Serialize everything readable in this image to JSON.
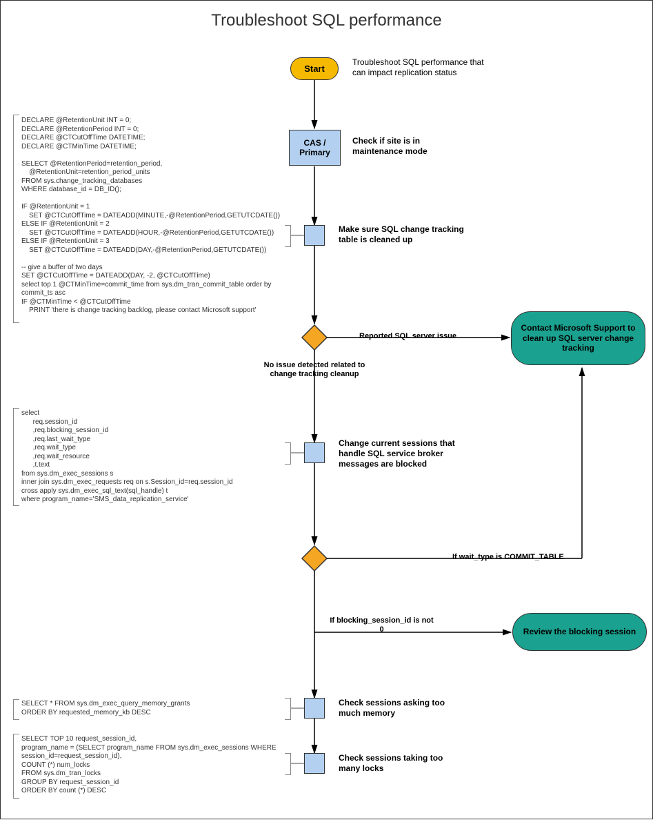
{
  "title": "Troubleshoot SQL performance",
  "nodes": {
    "start": "Start",
    "cas": "CAS / Primary",
    "contact": "Contact Microsoft Support to clean up SQL server change tracking",
    "review": "Review the blocking session"
  },
  "labels": {
    "start_desc": "Troubleshoot SQL performance that can impact replication status",
    "maint": "Check if site is in maintenance mode",
    "cleanup": "Make sure SQL change tracking table is cleaned up",
    "blocked": "Change current sessions that handle SQL service broker messages are blocked",
    "memory": "Check sessions asking too much memory",
    "locks": "Check sessions taking too many locks"
  },
  "edges": {
    "reported": "Reported SQL server issue",
    "noissue": "No issue detected related to change tracking cleanup",
    "commit": "If wait_type is COMMIT_TABLE",
    "notzero": "If blocking_session_id is not 0"
  },
  "code": {
    "c1": "DECLARE @RetentionUnit INT = 0;\nDECLARE @RetentionPeriod INT = 0;\nDECLARE @CTCutOffTime DATETIME;\nDECLARE @CTMinTime DATETIME;\n\nSELECT @RetentionPeriod=retention_period,\n    @RetentionUnit=retention_period_units\nFROM sys.change_tracking_databases\nWHERE database_id = DB_ID();\n\nIF @RetentionUnit = 1\n    SET @CTCutOffTime = DATEADD(MINUTE,-@RetentionPeriod,GETUTCDATE())\nELSE IF @RetentionUnit = 2\n    SET @CTCutOffTime = DATEADD(HOUR,-@RetentionPeriod,GETUTCDATE())\nELSE IF @RetentionUnit = 3\n    SET @CTCutOffTime = DATEADD(DAY,-@RetentionPeriod,GETUTCDATE())\n\n-- give a buffer of two days\nSET @CTCutOffTime = DATEADD(DAY, -2, @CTCutOffTime)\nselect top 1 @CTMinTime=commit_time from sys.dm_tran_commit_table order by\ncommit_ts asc\nIF @CTMinTime < @CTCutOffTime\n    PRINT 'there is change tracking backlog, please contact Microsoft support'",
    "c2": "select\n      req.session_id\n      ,req.blocking_session_id\n      ,req.last_wait_type\n      ,req.wait_type\n      ,req.wait_resource\n      ,t.text\nfrom sys.dm_exec_sessions s\ninner join sys.dm_exec_requests req on s.Session_id=req.session_id\ncross apply sys.dm_exec_sql_text(sql_handle) t\nwhere program_name='SMS_data_replication_service'",
    "c3": "SELECT * FROM sys.dm_exec_query_memory_grants\nORDER BY requested_memory_kb DESC",
    "c4": "SELECT TOP 10 request_session_id,\nprogram_name = (SELECT program_name FROM sys.dm_exec_sessions WHERE\nsession_id=request_session_id),\nCOUNT (*) num_locks\nFROM sys.dm_tran_locks\nGROUP BY request_session_id\nORDER BY count (*) DESC"
  }
}
